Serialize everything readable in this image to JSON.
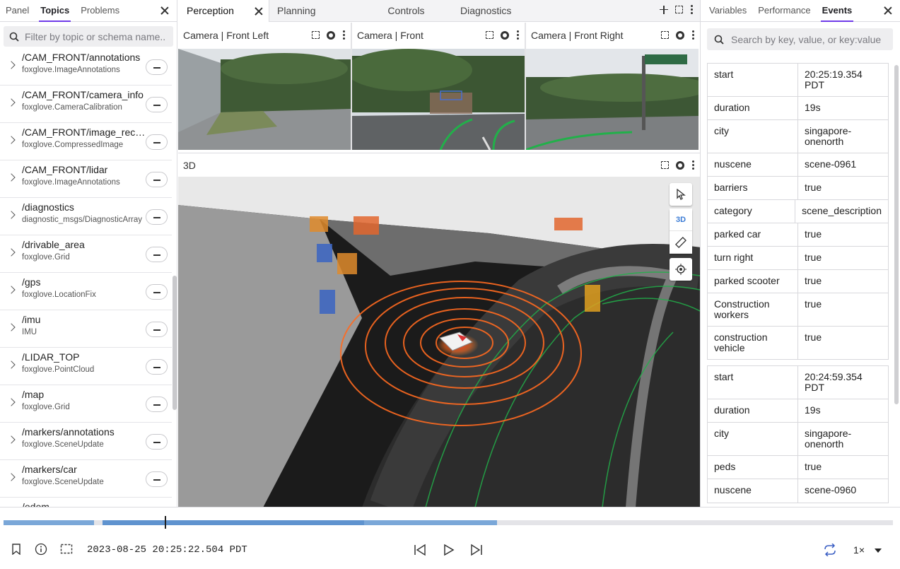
{
  "left_panel": {
    "tabs": [
      "Panel",
      "Topics",
      "Problems"
    ],
    "active_tab": "Topics",
    "filter_placeholder": "Filter by topic or schema name...",
    "topics": [
      {
        "name": "/CAM_FRONT/annotations",
        "schema": "foxglove.ImageAnnotations"
      },
      {
        "name": "/CAM_FRONT/camera_info",
        "schema": "foxglove.CameraCalibration"
      },
      {
        "name": "/CAM_FRONT/image_rect_c...",
        "schema": "foxglove.CompressedImage"
      },
      {
        "name": "/CAM_FRONT/lidar",
        "schema": "foxglove.ImageAnnotations"
      },
      {
        "name": "/diagnostics",
        "schema": "diagnostic_msgs/DiagnosticArray"
      },
      {
        "name": "/drivable_area",
        "schema": "foxglove.Grid"
      },
      {
        "name": "/gps",
        "schema": "foxglove.LocationFix"
      },
      {
        "name": "/imu",
        "schema": "IMU"
      },
      {
        "name": "/LIDAR_TOP",
        "schema": "foxglove.PointCloud"
      },
      {
        "name": "/map",
        "schema": "foxglove.Grid"
      },
      {
        "name": "/markers/annotations",
        "schema": "foxglove.SceneUpdate"
      },
      {
        "name": "/markers/car",
        "schema": "foxglove.SceneUpdate"
      },
      {
        "name": "/odom",
        "schema": ""
      }
    ]
  },
  "center": {
    "tabs": [
      "Perception",
      "Planning",
      "Controls",
      "Diagnostics"
    ],
    "active_tab": "Perception",
    "cameras": [
      {
        "title": "Camera | Front Left"
      },
      {
        "title": "Camera | Front"
      },
      {
        "title": "Camera | Front Right"
      }
    ],
    "view3d_title": "3D",
    "view3d_toggle_label": "3D"
  },
  "right_panel": {
    "tabs": [
      "Variables",
      "Performance",
      "Events"
    ],
    "active_tab": "Events",
    "search_placeholder": "Search by key, value, or key:value",
    "events": [
      {
        "rows": [
          {
            "k": "start",
            "v": "20:25:19.354 PDT"
          },
          {
            "k": "duration",
            "v": "19s"
          },
          {
            "k": "city",
            "v": "singapore-onenorth"
          },
          {
            "k": "nuscene",
            "v": "scene-0961"
          },
          {
            "k": "barriers",
            "v": "true"
          },
          {
            "k": "category",
            "v": "scene_description"
          },
          {
            "k": "parked car",
            "v": "true"
          },
          {
            "k": "turn right",
            "v": "true"
          },
          {
            "k": "parked scooter",
            "v": "true"
          },
          {
            "k": "Construction workers",
            "v": "true"
          },
          {
            "k": "construction vehicle",
            "v": "true"
          }
        ]
      },
      {
        "rows": [
          {
            "k": "start",
            "v": "20:24:59.354 PDT"
          },
          {
            "k": "duration",
            "v": "19s"
          },
          {
            "k": "city",
            "v": "singapore-onenorth"
          },
          {
            "k": "peds",
            "v": "true"
          },
          {
            "k": "nuscene",
            "v": "scene-0960"
          }
        ]
      }
    ]
  },
  "playback": {
    "timestamp": "2023-08-25 20:25:22.504 PDT",
    "speed": "1×"
  },
  "colors": {
    "accent": "#6f3be8",
    "timeline": "#7aa7d8"
  }
}
